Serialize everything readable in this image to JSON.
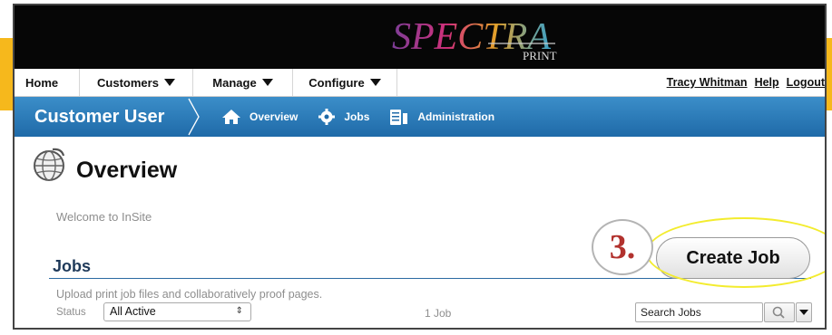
{
  "brand": {
    "logo_text": "SPECTRA",
    "logo_subtext": "PRINT"
  },
  "menubar": {
    "items": [
      {
        "label": "Home"
      },
      {
        "label": "Customers"
      },
      {
        "label": "Manage"
      },
      {
        "label": "Configure"
      }
    ],
    "user_links": [
      "Tracy Whitman",
      "Help",
      "Logout"
    ]
  },
  "navbar": {
    "title": "Customer User",
    "links": [
      {
        "label": "Overview",
        "icon": "home-icon"
      },
      {
        "label": "Jobs",
        "icon": "gear-icon"
      },
      {
        "label": "Administration",
        "icon": "clipboard-icon"
      }
    ]
  },
  "page": {
    "title": "Overview",
    "welcome": "Welcome to InSite"
  },
  "jobs": {
    "title": "Jobs",
    "description": "Upload print job files and collaboratively proof pages.",
    "status_label": "Status",
    "status_value": "All Active",
    "count_text": "1 Job",
    "search_placeholder": "Search Jobs",
    "create_label": "Create Job"
  },
  "annotation": {
    "step": "3."
  },
  "colors": {
    "accent": "#f6b81c",
    "nav_blue": "#1f6aa8",
    "highlight": "#f3ec2e",
    "step_red": "#b2322e"
  }
}
